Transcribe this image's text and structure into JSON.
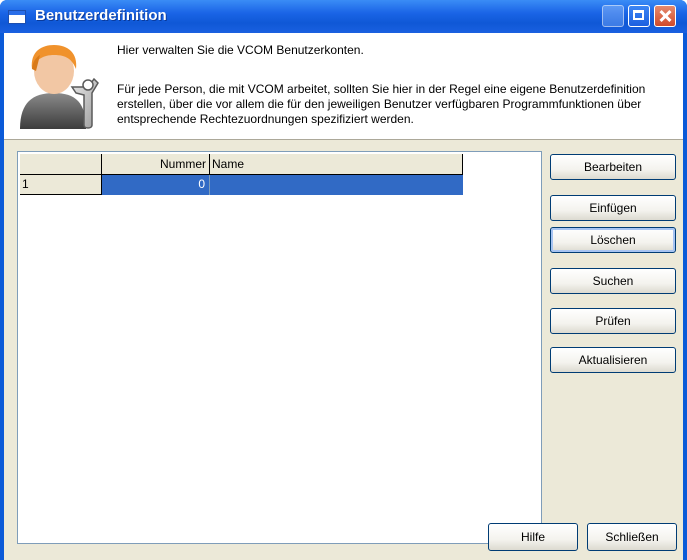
{
  "window": {
    "title": "Benutzerdefinition",
    "controls": [
      "minimize-icon",
      "maximize-icon",
      "close-icon"
    ]
  },
  "header": {
    "intro_line": "Hier verwalten Sie die VCOM Benutzerkonten.",
    "description": "Für jede Person, die mit VCOM arbeitet, sollten Sie hier in der Regel eine eigene Benutzerdefinition erstellen, über die vor allem die für den jeweiligen Benutzer verfügbaren Programmfunktionen über entsprechende Rechtezuordnungen spezifiziert werden.",
    "icon": "user-settings-icon"
  },
  "table": {
    "columns": [
      "",
      "Nummer",
      "Name"
    ],
    "rows": [
      {
        "index": "1",
        "nummer": "0",
        "name": ""
      }
    ]
  },
  "side_buttons": {
    "bearbeiten": "Bearbeiten",
    "einfuegen": "Einfügen",
    "loeschen": "Löschen",
    "suchen": "Suchen",
    "pruefen": "Prüfen",
    "aktualisieren": "Aktualisieren"
  },
  "footer": {
    "hilfe": "Hilfe",
    "schliessen": "Schließen"
  },
  "colors": {
    "titlebar": "#0f58d6",
    "selection": "#316ac5",
    "dialog_bg": "#ece9d8"
  }
}
